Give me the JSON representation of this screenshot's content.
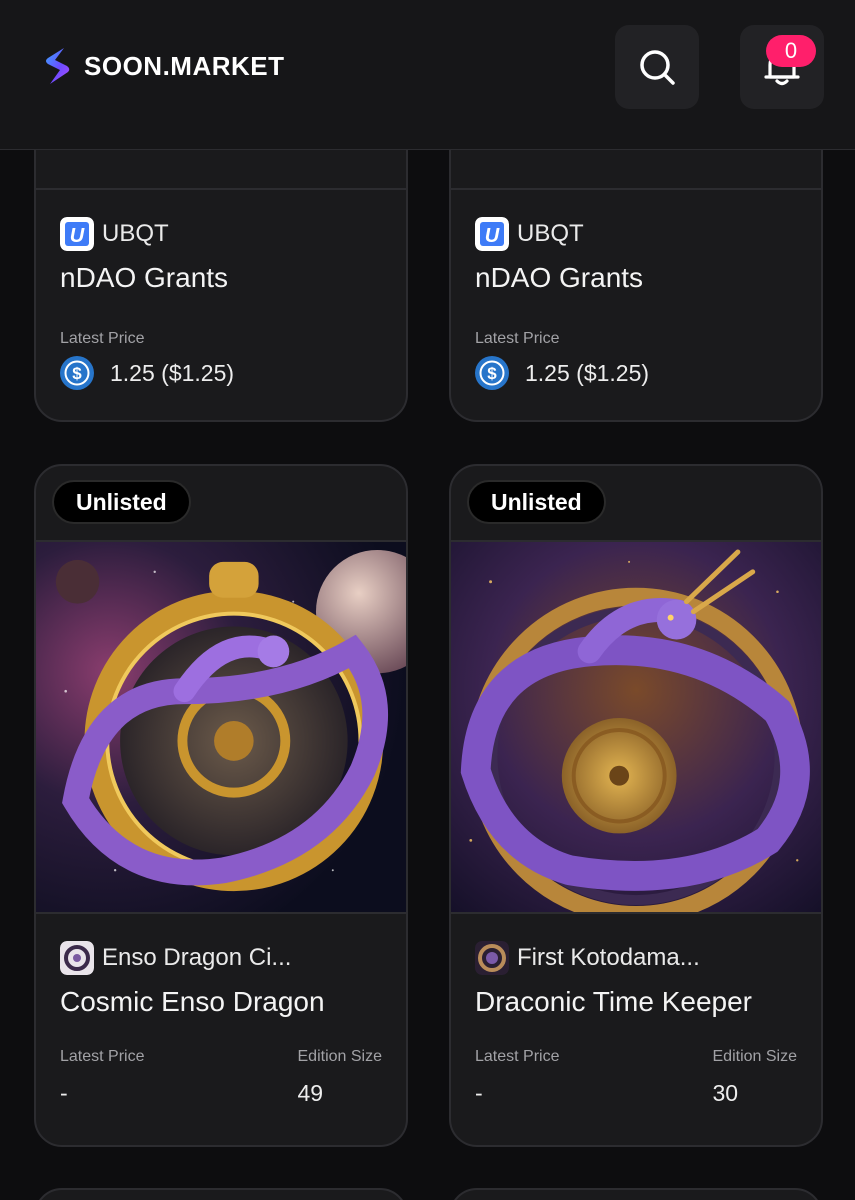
{
  "header": {
    "brand": "SOON.MARKET",
    "notification_count": "0",
    "search_icon": "search-icon",
    "bell_icon": "bell-icon"
  },
  "cards_top": [
    {
      "collection": "UBQT",
      "name": "nDAO Grants",
      "price_label": "Latest Price",
      "price": "1.25 ($1.25)",
      "currency_icon": "usdc-icon"
    },
    {
      "collection": "UBQT",
      "name": "nDAO Grants",
      "price_label": "Latest Price",
      "price": "1.25 ($1.25)",
      "currency_icon": "usdc-icon"
    }
  ],
  "cards_main": [
    {
      "tag": "Unlisted",
      "collection": "Enso Dragon Ci...",
      "name": "Cosmic Enso Dragon",
      "price_label": "Latest Price",
      "price": "-",
      "edition_label": "Edition Size",
      "edition": "49"
    },
    {
      "tag": "Unlisted",
      "collection": "First Kotodama...",
      "name": "Draconic Time Keeper",
      "price_label": "Latest Price",
      "price": "-",
      "edition_label": "Edition Size",
      "edition": "30"
    }
  ],
  "colors": {
    "background": "#0d0d0f",
    "card": "#1a1a1c",
    "badge": "#ff1f6b",
    "usdc": "#2775ca"
  }
}
